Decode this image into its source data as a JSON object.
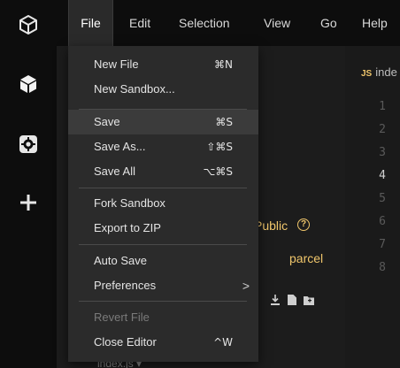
{
  "menubar": {
    "items": [
      "File",
      "Edit",
      "Selection",
      "View",
      "Go",
      "Help"
    ],
    "active": "File"
  },
  "activity_bar": {
    "icons": [
      "codesandbox-logo-icon",
      "cube-icon",
      "gear-icon",
      "plus-icon"
    ]
  },
  "file_menu": {
    "new_file": {
      "label": "New File",
      "shortcut": "⌘N"
    },
    "new_sandbox": {
      "label": "New Sandbox..."
    },
    "save": {
      "label": "Save",
      "shortcut": "⌘S"
    },
    "save_as": {
      "label": "Save As...",
      "shortcut": "⇧⌘S"
    },
    "save_all": {
      "label": "Save All",
      "shortcut": "⌥⌘S"
    },
    "fork_sandbox": {
      "label": "Fork Sandbox"
    },
    "export_zip": {
      "label": "Export to ZIP"
    },
    "auto_save": {
      "label": "Auto Save"
    },
    "preferences": {
      "label": "Preferences",
      "arrow": ">"
    },
    "revert_file": {
      "label": "Revert File"
    },
    "close_editor": {
      "label": "Close Editor",
      "shortcut": "^W"
    }
  },
  "sidebar": {
    "privacy": "Public",
    "help_glyph": "?",
    "template": "parcel",
    "partial_file": "index.js ▾"
  },
  "editor": {
    "tab_badge": "JS",
    "tab_name": "inde",
    "line_numbers": [
      "1",
      "2",
      "3",
      "4",
      "5",
      "6",
      "7",
      "8"
    ],
    "current_line": "4"
  },
  "colors": {
    "accent_yellow": "#f0c66b",
    "menu_bg": "#2b2b2b",
    "hover_bg": "#3b3b3b"
  }
}
